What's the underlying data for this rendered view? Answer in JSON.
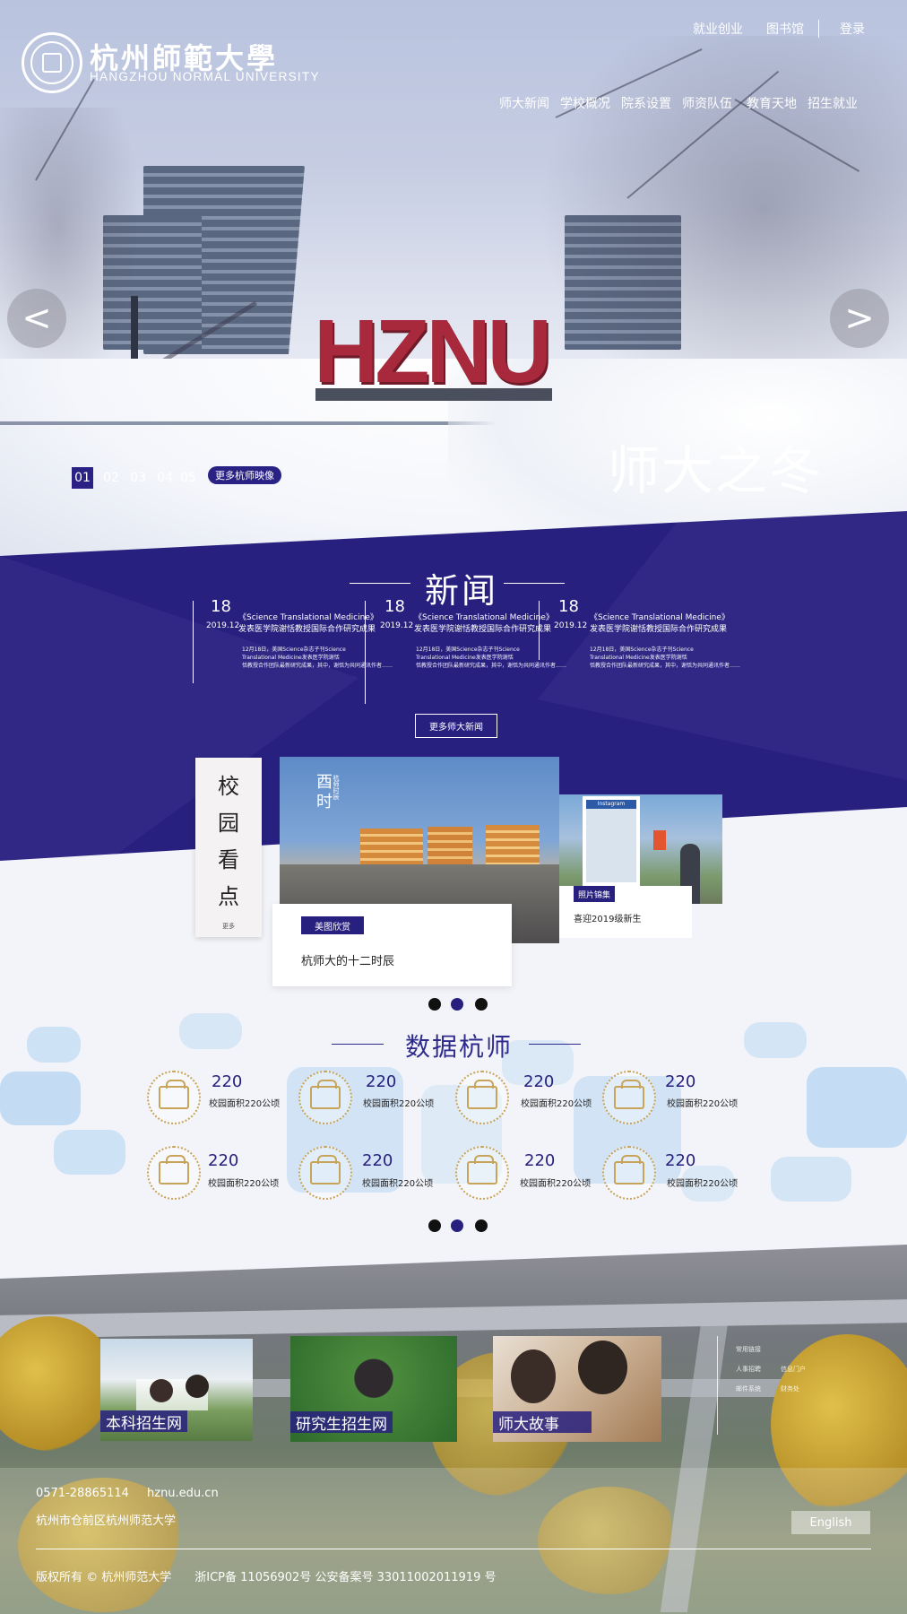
{
  "header": {
    "logo_cn": "杭州師範大學",
    "logo_en": "HANGZHOU NORMAL UNIVERSITY",
    "top_links": [
      "就业创业",
      "图书馆",
      "登录"
    ],
    "nav": [
      "师大新闻",
      "学校概况",
      "院系设置",
      "师资队伍",
      "教育天地",
      "招生就业"
    ]
  },
  "hero": {
    "sign_text": "HZNU",
    "caption": "师大之冬",
    "pages": [
      "01",
      "02",
      "03",
      "04",
      "05"
    ],
    "active_page": "01",
    "more_label": "更多杭师映像",
    "prev_glyph": "<",
    "next_glyph": ">"
  },
  "news": {
    "title": "新闻",
    "items": [
      {
        "day": "18",
        "ym": "2019.12",
        "headline1": "《Science Translational Medicine》",
        "headline2": "发表医学院谢恬教授国际合作研究成果",
        "body1": "12月18日，美国Science杂志子刊Science",
        "body2": "Translational Medicine发表医学院谢恬",
        "body3": "恬教授合作团队最新研究成果，其中，谢恬为共同通讯作者……"
      },
      {
        "day": "18",
        "ym": "2019.12",
        "headline1": "《Science Translational Medicine》",
        "headline2": "发表医学院谢恬教授国际合作研究成果",
        "body1": "12月18日，美国Science杂志子刊Science",
        "body2": "Translational Medicine发表医学院谢恬",
        "body3": "恬教授合作团队最新研究成果，其中，谢恬为共同通讯作者……"
      },
      {
        "day": "18",
        "ym": "2019.12",
        "headline1": "《Science Translational Medicine》",
        "headline2": "发表医学院谢恬教授国际合作研究成果",
        "body1": "12月18日，美国Science杂志子刊Science",
        "body2": "Translational Medicine发表医学院谢恬",
        "body3": "恬教授合作团队最新研究成果，其中，谢恬为共同通讯作者……"
      }
    ],
    "more_label": "更多师大新闻"
  },
  "campus": {
    "title_chars": [
      "校",
      "园",
      "看",
      "点"
    ],
    "more": "更多",
    "main_photo_overlay": "酉时",
    "main_photo_small": "杭师时辰",
    "main_tag": "美图欣赏",
    "main_caption": "杭师大的十二时辰",
    "side_photo_sign": "Instagram",
    "side_tag": "照片锦集",
    "side_caption": "喜迎2019级新生"
  },
  "stats": {
    "title": "数据杭师",
    "items": [
      {
        "value": "220",
        "label": "校园面积220公顷",
        "icon": "campus-building-icon"
      },
      {
        "value": "220",
        "label": "校园面积220公顷",
        "icon": "tree-icon"
      },
      {
        "value": "220",
        "label": "校园面积220公顷",
        "icon": "library-icon"
      },
      {
        "value": "220",
        "label": "校园面积220公顷",
        "icon": "lab-icon"
      },
      {
        "value": "220",
        "label": "校园面积220公顷",
        "icon": "gate-icon"
      },
      {
        "value": "220",
        "label": "校园面积220公顷",
        "icon": "flower-icon"
      },
      {
        "value": "220",
        "label": "校园面积220公顷",
        "icon": "students-icon"
      },
      {
        "value": "220",
        "label": "校园面积220公顷",
        "icon": "tools-icon"
      }
    ]
  },
  "carousel_dots": 3,
  "footer": {
    "portals": [
      "本科招生网",
      "研究生招生网",
      "师大故事"
    ],
    "quick_links": [
      "常用链接",
      "人事招聘",
      "信息门户",
      "邮件系统",
      "财务处"
    ],
    "phone": "0571-28865114",
    "site": "hznu.edu.cn",
    "address": "杭州市仓前区杭州师范大学",
    "english": "English",
    "copyright": "版权所有 © 杭州师范大学　　浙ICP备 11056902号 公安备案号 33011002011919 号"
  },
  "colors": {
    "brand": "#28207f",
    "gold": "#c7a45a",
    "sign": "#a8293b"
  }
}
